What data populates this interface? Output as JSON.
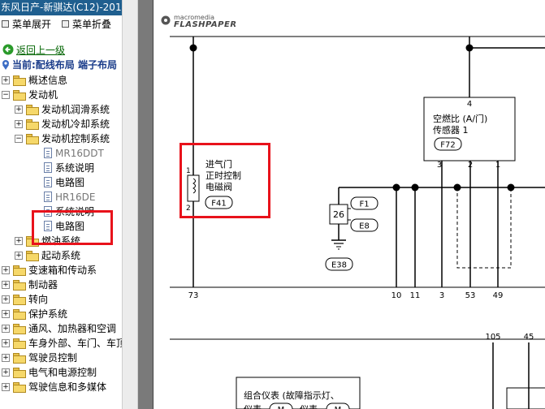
{
  "window": {
    "title": "东风日产-新骐达(C12)-201"
  },
  "toolbar": {
    "expand": "菜单展开",
    "collapse": "菜单折叠"
  },
  "nav": {
    "back": "返回上一级",
    "current": "当前:配线布局 端子布局"
  },
  "tree": [
    {
      "label": "概述信息",
      "level": 0,
      "type": "folder",
      "pm": "+"
    },
    {
      "label": "发动机",
      "level": 0,
      "type": "folder",
      "pm": "−"
    },
    {
      "label": "发动机润滑系统",
      "level": 1,
      "type": "folder",
      "pm": "+"
    },
    {
      "label": "发动机冷却系统",
      "level": 1,
      "type": "folder",
      "pm": "+"
    },
    {
      "label": "发动机控制系统",
      "level": 1,
      "type": "folder",
      "pm": "−"
    },
    {
      "label": "MR16DDT",
      "level": 2,
      "type": "doc",
      "gray": true
    },
    {
      "label": "系统说明",
      "level": 2,
      "type": "doc"
    },
    {
      "label": "电路图",
      "level": 2,
      "type": "doc"
    },
    {
      "label": "HR16DE",
      "level": 2,
      "type": "doc",
      "gray": true
    },
    {
      "label": "系统说明",
      "level": 2,
      "type": "doc"
    },
    {
      "label": "电路图",
      "level": 2,
      "type": "doc",
      "selected": true
    },
    {
      "label": "燃油系统",
      "level": 1,
      "type": "folder",
      "pm": "+"
    },
    {
      "label": "起动系统",
      "level": 1,
      "type": "folder",
      "pm": "+"
    },
    {
      "label": "变速箱和传动系",
      "level": 0,
      "type": "folder",
      "pm": "+"
    },
    {
      "label": "制动器",
      "level": 0,
      "type": "folder",
      "pm": "+"
    },
    {
      "label": "转向",
      "level": 0,
      "type": "folder",
      "pm": "+"
    },
    {
      "label": "保护系统",
      "level": 0,
      "type": "folder",
      "pm": "+"
    },
    {
      "label": "通风、加热器和空调",
      "level": 0,
      "type": "folder",
      "pm": "+"
    },
    {
      "label": "车身外部、车门、车顶",
      "level": 0,
      "type": "folder",
      "pm": "+"
    },
    {
      "label": "驾驶员控制",
      "level": 0,
      "type": "folder",
      "pm": "+"
    },
    {
      "label": "电气和电源控制",
      "level": 0,
      "type": "folder",
      "pm": "+"
    },
    {
      "label": "驾驶信息和多媒体",
      "level": 0,
      "type": "folder",
      "pm": "+"
    }
  ],
  "viewer": {
    "brand_small": "macromedia",
    "brand_large": "FLASHPAPER"
  },
  "diagram": {
    "valve": {
      "line1": "进气门",
      "line2": "正时控制",
      "line3": "电磁阀",
      "connector": "F41",
      "pin1": "1",
      "pin2": "2"
    },
    "sensor": {
      "line1": "空燃比 (A/门)",
      "line2": "传感器 1",
      "connector": "F72",
      "pin_top": "4",
      "pin3": "3",
      "pin2": "2",
      "pin1": "1"
    },
    "junction": {
      "num": "26",
      "conn_a": "F1",
      "conn_b": "E8",
      "ground": "E38"
    },
    "bottom_numbers": [
      "73",
      "10",
      "11",
      "3",
      "53",
      "49"
    ],
    "lower_numbers": [
      "105",
      "45"
    ],
    "cluster": {
      "line1": "组合仪表 (故障指示灯、",
      "line2_a": "仪表",
      "line2_b": "M",
      "line2_c": "仪表",
      "line2_d": "M"
    }
  },
  "colors": {
    "titlebar": "#1f5f8f",
    "highlight": "#e8121b",
    "link": "#006400"
  }
}
